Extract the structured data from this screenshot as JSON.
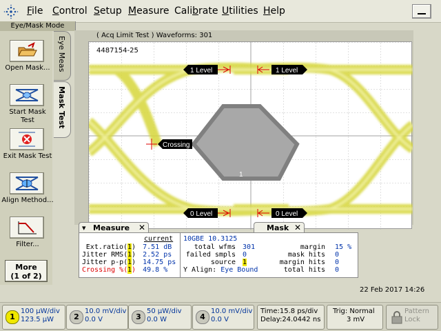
{
  "menu": {
    "items": [
      "File",
      "Control",
      "Setup",
      "Measure",
      "Calibrate",
      "Utilities",
      "Help"
    ],
    "underline": [
      "F",
      "C",
      "S",
      "M",
      "b",
      "U",
      "H"
    ]
  },
  "mode_label": "Eye/Mask Mode",
  "left_panel": {
    "buttons": [
      {
        "label": "Open Mask...",
        "icon": "open-mask-icon"
      },
      {
        "label": "Start Mask Test",
        "icon": "start-mask-test-icon"
      },
      {
        "label": "Exit Mask Test",
        "icon": "exit-mask-test-icon"
      },
      {
        "label": "Align Method...",
        "icon": "align-method-icon"
      },
      {
        "label": "Filter...",
        "icon": "filter-icon"
      }
    ],
    "more_label_1": "More",
    "more_label_2": "(1 of 2)"
  },
  "tabs": {
    "eye_meas": "Eye Meas",
    "mask_test": "Mask Test"
  },
  "display": {
    "acq_label": "( Acq Limit Test )  Waveforms: 301",
    "scope_id": "4487154-25",
    "mask_number": "1",
    "markers": {
      "top_left": "1 Level",
      "top_right": "1 Level",
      "crossing": "Crossing",
      "bottom_left": "0 Level",
      "bottom_right": "0 Level"
    }
  },
  "measure_panel": {
    "tab": "Measure",
    "header": "current",
    "rows": [
      {
        "label": "Ext.ratio(",
        "ch": "1",
        "close": ")",
        "value": "7.51 dB"
      },
      {
        "label": "Jitter RMS(",
        "ch": "1",
        "close": ")",
        "value": "2.52 ps"
      },
      {
        "label": "Jitter p-p(",
        "ch": "1",
        "close": ")",
        "value": "14.75 ps"
      },
      {
        "label": "Crossing %(",
        "ch": "1",
        "close": ")",
        "value": "49.8 %"
      }
    ]
  },
  "mask_panel": {
    "tab": "Mask",
    "title": "10GBE 10.3125",
    "rows_left": [
      {
        "label": "total wfms",
        "value": "301"
      },
      {
        "label": "failed smpls",
        "value": "0"
      },
      {
        "label": "source",
        "value": "1"
      },
      {
        "label": "Y Align:",
        "value": "Eye Bound"
      }
    ],
    "rows_right": [
      {
        "label": "margin",
        "value": "15 %"
      },
      {
        "label": "mask hits",
        "value": "0"
      },
      {
        "label": "margin hits",
        "value": "0"
      },
      {
        "label": "total hits",
        "value": "0"
      }
    ]
  },
  "date_time": "22 Feb 2017   14:26",
  "channels": [
    {
      "num": "1",
      "scale": "100 µW/div",
      "offset": "123.5 µW"
    },
    {
      "num": "2",
      "scale": "10.0 mV/div",
      "offset": "0.0 V"
    },
    {
      "num": "3",
      "scale": "50 µW/div",
      "offset": "0.0 W"
    },
    {
      "num": "4",
      "scale": "10.0 mV/div",
      "offset": "0.0 V"
    }
  ],
  "timebase": {
    "time": "Time:15.8 ps/div",
    "delay": "Delay:24.0442 ns"
  },
  "trigger": {
    "trig": "Trig: Normal",
    "level": "3 mV"
  },
  "pattern_lock": {
    "line1": "Pattern",
    "line2": "Lock"
  },
  "colors": {
    "trace": "#d4d432",
    "mask": "#909090",
    "ch1": "#f0e800",
    "value_blue": "#0033aa",
    "crossing_red": "#dd0000"
  }
}
